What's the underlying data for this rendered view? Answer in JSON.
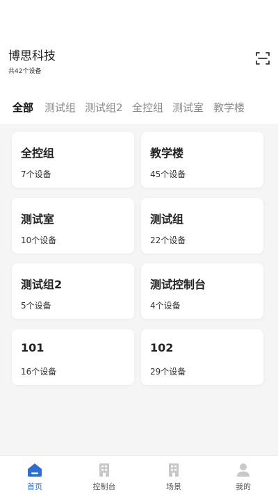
{
  "header": {
    "company": "博思科技",
    "device_total": "共42个设备",
    "scan_icon": "scan-icon"
  },
  "tabs": [
    {
      "label": "全部",
      "active": true
    },
    {
      "label": "测试组",
      "active": false
    },
    {
      "label": "测试组2",
      "active": false
    },
    {
      "label": "全控组",
      "active": false
    },
    {
      "label": "测试室",
      "active": false
    },
    {
      "label": "教学楼",
      "active": false
    }
  ],
  "groups": [
    {
      "name": "全控组",
      "count": "7个设备"
    },
    {
      "name": "教学楼",
      "count": "45个设备"
    },
    {
      "name": "测试室",
      "count": "10个设备"
    },
    {
      "name": "测试组",
      "count": "22个设备"
    },
    {
      "name": "测试组2",
      "count": "5个设备"
    },
    {
      "name": "测试控制台",
      "count": "4个设备"
    },
    {
      "name": "101",
      "count": "16个设备"
    },
    {
      "name": "102",
      "count": "29个设备"
    }
  ],
  "bottom_nav": [
    {
      "label": "首页",
      "icon": "home-icon",
      "active": true
    },
    {
      "label": "控制台",
      "icon": "building-icon",
      "active": false
    },
    {
      "label": "场景",
      "icon": "building-icon",
      "active": false
    },
    {
      "label": "我的",
      "icon": "user-icon",
      "active": false
    }
  ],
  "colors": {
    "accent": "#2b6fd6",
    "inactive_icon": "#c8c8c8",
    "content_bg": "#f5f5f5"
  }
}
